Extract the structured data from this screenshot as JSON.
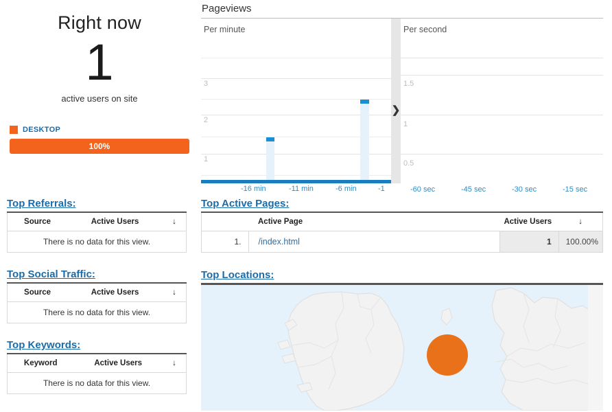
{
  "right_now": {
    "title": "Right now",
    "count": "1",
    "subtitle": "active users on site",
    "device_legend_label": "DESKTOP",
    "device_bar_value": "100%",
    "device_color": "#F4631E",
    "accent_blue": "#1b6ca8"
  },
  "pageviews": {
    "title": "Pageviews",
    "per_minute_label": "Per minute",
    "per_second_label": "Per second",
    "next_arrow": "❯"
  },
  "chart_data": [
    {
      "type": "bar",
      "title": "Pageviews",
      "subtitle": "Per minute",
      "xlabel": "",
      "ylabel": "",
      "ylim": [
        0,
        3.6
      ],
      "yticks": [
        1,
        2,
        3
      ],
      "ytick_labels": [
        "1",
        "2",
        "3"
      ],
      "grid": true,
      "xtick_labels": [
        "-16 min",
        "-11 min",
        "-6 min",
        "-1"
      ],
      "xtick_positions_min": [
        -16,
        -11,
        -6,
        -1
      ],
      "x": [
        -30,
        -29,
        -28,
        -27,
        -26,
        -25,
        -24,
        -23,
        -22,
        -21,
        -20,
        -19,
        -18,
        -17,
        -16,
        -15,
        -14,
        -13,
        -12,
        -11,
        -10,
        -9,
        -8,
        -7,
        -6,
        -5,
        -4,
        -3,
        -2,
        -1
      ],
      "values": [
        0,
        0,
        0,
        0,
        0,
        0,
        0,
        0,
        0,
        0,
        0,
        0,
        0,
        0,
        0,
        1,
        0,
        0,
        0,
        0,
        0,
        0,
        0,
        0,
        0,
        0,
        0,
        2,
        0,
        0
      ],
      "bar_body_color": "#e6f2fb",
      "bar_cap_color": "#1a8fd1",
      "axis_color": "#1a7dc0"
    },
    {
      "type": "bar",
      "title": "Pageviews",
      "subtitle": "Per second",
      "xlabel": "",
      "ylabel": "",
      "ylim": [
        0,
        1.8
      ],
      "yticks": [
        0.5,
        1,
        1.5
      ],
      "ytick_labels": [
        "0.5",
        "1",
        "1.5"
      ],
      "grid": true,
      "xtick_labels": [
        "-60 sec",
        "-45 sec",
        "-30 sec",
        "-15 sec"
      ],
      "xtick_positions_sec": [
        -60,
        -45,
        -30,
        -15
      ],
      "x": [
        -60,
        -55,
        -50,
        -45,
        -40,
        -35,
        -30,
        -25,
        -20,
        -15,
        -10,
        -5
      ],
      "values": [
        0,
        0,
        0,
        0,
        0,
        0,
        0,
        0,
        0,
        0,
        0,
        0
      ],
      "bar_body_color": "#e6f2fb",
      "bar_cap_color": "#1a8fd1",
      "axis_color": "#1a7dc0"
    }
  ],
  "top_referrals": {
    "heading": "Top Referrals:",
    "columns": [
      "Source",
      "Active Users"
    ],
    "sort_icon": "↓",
    "empty_message": "There is no data for this view.",
    "rows": []
  },
  "top_social": {
    "heading": "Top Social Traffic:",
    "columns": [
      "Source",
      "Active Users"
    ],
    "sort_icon": "↓",
    "empty_message": "There is no data for this view.",
    "rows": []
  },
  "top_keywords": {
    "heading": "Top Keywords:",
    "columns": [
      "Keyword",
      "Active Users"
    ],
    "sort_icon": "↓",
    "empty_message": "There is no data for this view.",
    "rows": []
  },
  "top_active_pages": {
    "heading": "Top Active Pages:",
    "columns": [
      "Active Page",
      "Active Users"
    ],
    "sort_icon": "↓",
    "rows": [
      {
        "index": "1.",
        "page": "/index.html",
        "users": "1",
        "percent": "100.00%"
      }
    ]
  },
  "top_locations": {
    "heading": "Top Locations:",
    "marker_color": "#E8711A",
    "water_color": "#e6f2fb",
    "land_color": "#f2f2f2"
  }
}
